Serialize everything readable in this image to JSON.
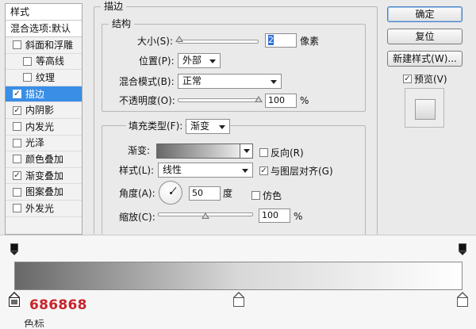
{
  "left_panel": {
    "header": "样式",
    "subheader": "混合选项:默认",
    "items": [
      {
        "label": "斜面和浮雕",
        "checked": false,
        "indent": false,
        "selected": false
      },
      {
        "label": "等高线",
        "checked": false,
        "indent": true,
        "selected": false
      },
      {
        "label": "纹理",
        "checked": false,
        "indent": true,
        "selected": false
      },
      {
        "label": "描边",
        "checked": true,
        "indent": false,
        "selected": true
      },
      {
        "label": "内阴影",
        "checked": true,
        "indent": false,
        "selected": false
      },
      {
        "label": "内发光",
        "checked": false,
        "indent": false,
        "selected": false
      },
      {
        "label": "光泽",
        "checked": false,
        "indent": false,
        "selected": false
      },
      {
        "label": "颜色叠加",
        "checked": false,
        "indent": false,
        "selected": false
      },
      {
        "label": "渐变叠加",
        "checked": true,
        "indent": false,
        "selected": false
      },
      {
        "label": "图案叠加",
        "checked": false,
        "indent": false,
        "selected": false
      },
      {
        "label": "外发光",
        "checked": false,
        "indent": false,
        "selected": false
      }
    ]
  },
  "stroke": {
    "title": "描边",
    "structure": {
      "title": "结构",
      "size_label": "大小(S):",
      "size_value": "2",
      "size_unit": "像素",
      "size_slider_fraction": 0.02,
      "position_label": "位置(P):",
      "position_value": "外部",
      "blend_label": "混合模式(B):",
      "blend_value": "正常",
      "opacity_label": "不透明度(O):",
      "opacity_value": "100",
      "opacity_unit": "%",
      "opacity_slider_fraction": 1.0
    },
    "fill": {
      "type_label": "填充类型(F):",
      "type_value": "渐变",
      "gradient_label": "渐变:",
      "reverse_label": "反向(R)",
      "reverse_checked": false,
      "style_label": "样式(L):",
      "style_value": "线性",
      "align_label": "与图层对齐(G)",
      "align_checked": true,
      "angle_label": "角度(A):",
      "angle_value": "50",
      "angle_unit": "度",
      "dither_label": "仿色",
      "dither_checked": false,
      "scale_label": "缩放(C):",
      "scale_value": "100",
      "scale_unit": "%",
      "scale_slider_fraction": 0.5
    }
  },
  "buttons": {
    "ok": "确定",
    "reset": "复位",
    "new_style": "新建样式(W)...",
    "preview_label": "预览(V)",
    "preview_checked": true
  },
  "gradient_editor": {
    "start_color_hex": "686868",
    "cut_text": "色标",
    "stops_bottom_fraction": [
      0.0,
      0.5,
      1.0
    ],
    "stops_top_fraction": [
      0.0,
      1.0
    ]
  },
  "colors": {
    "selection": "#3a8ee6",
    "hex_text": "#c8242b",
    "gradient_start": "#686868",
    "gradient_end": "#ffffff"
  }
}
